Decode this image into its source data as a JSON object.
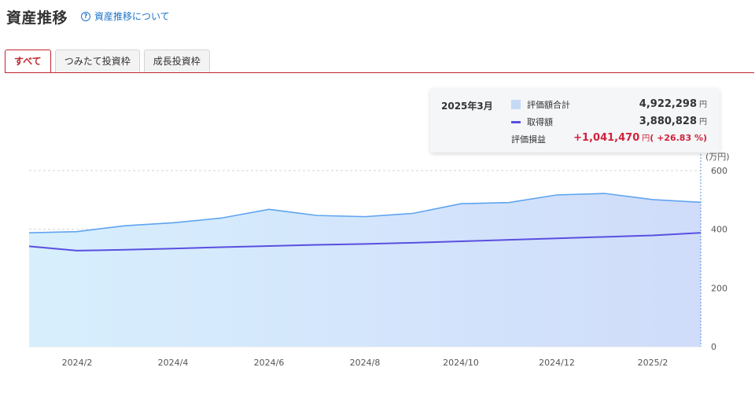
{
  "header": {
    "title": "資産推移",
    "help_link": "資産推移について",
    "help_icon": "question-circle-icon"
  },
  "tabs": [
    {
      "label": "すべて",
      "active": true
    },
    {
      "label": "つみたて投資枠",
      "active": false
    },
    {
      "label": "成長投資枠",
      "active": false
    }
  ],
  "colors": {
    "accent": "#c0262d",
    "valuation_line": "#5ea4f0",
    "acquisition_line": "#5a4fe0",
    "gain": "#d1223a",
    "link": "#1a73c9"
  },
  "tooltip": {
    "date": "2025年3月",
    "valuation_label": "評価額合計",
    "valuation_value": "4,922,298",
    "acquisition_label": "取得額",
    "acquisition_value": "3,880,828",
    "gain_label": "評価損益",
    "gain_value": "+1,041,470",
    "gain_pct": "( +26.83 %)",
    "unit": "円"
  },
  "chart_data": {
    "type": "area",
    "y_unit": "(万円)",
    "y_ticks": [
      "0",
      "200",
      "400",
      "600"
    ],
    "ylim": [
      0,
      600
    ],
    "x_tick_labels": [
      "2024/2",
      "2024/4",
      "2024/6",
      "2024/8",
      "2024/10",
      "2024/12",
      "2025/2"
    ],
    "x": [
      "2024/1",
      "2024/2",
      "2024/3",
      "2024/4",
      "2024/5",
      "2024/6",
      "2024/7",
      "2024/8",
      "2024/9",
      "2024/10",
      "2024/11",
      "2024/12",
      "2025/1",
      "2025/2",
      "2025/3"
    ],
    "series": [
      {
        "name": "評価額合計",
        "values": [
          388,
          392,
          412,
          422,
          438,
          468,
          447,
          443,
          454,
          487,
          491,
          517,
          522,
          501,
          492
        ]
      },
      {
        "name": "取得額",
        "values": [
          342,
          327,
          330,
          334,
          339,
          343,
          347,
          350,
          354,
          359,
          364,
          369,
          374,
          379,
          388
        ]
      }
    ],
    "grid": true,
    "legend": "tooltip"
  }
}
